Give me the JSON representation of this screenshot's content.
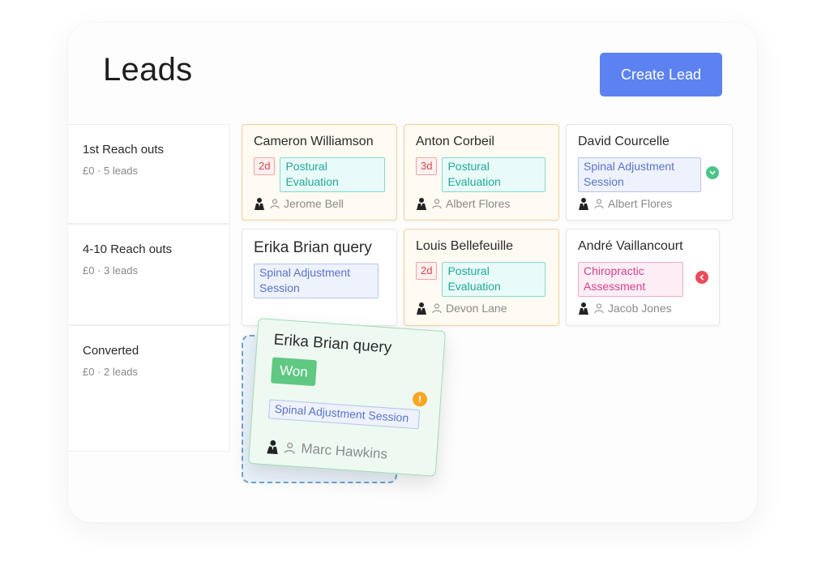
{
  "header": {
    "title": "Leads",
    "create_label": "Create Lead"
  },
  "stages": [
    {
      "name": "1st Reach outs",
      "amount": "£0",
      "count": "5 leads"
    },
    {
      "name": "4-10 Reach outs",
      "amount": "£0",
      "count": "3 leads"
    },
    {
      "name": "Converted",
      "amount": "£0",
      "count": "2 leads"
    }
  ],
  "cards": {
    "c1": {
      "name": "Cameron Williamson",
      "days": "2d",
      "tag": "Postural Evaluation",
      "owner": "Jerome Bell"
    },
    "c2": {
      "name": "Anton Corbeil",
      "days": "3d",
      "tag": "Postural Evaluation",
      "owner": "Albert Flores"
    },
    "c3": {
      "name": "David Courcelle",
      "tag": "Spinal Adjustment Session",
      "owner": "Albert Flores",
      "status": "ok"
    },
    "c4": {
      "name": "Erika Brian query",
      "tag": "Spinal Adjustment Session"
    },
    "c5": {
      "name": "Louis Bellefeuille",
      "days": "2d",
      "tag": "Postural Evaluation",
      "owner": "Devon Lane"
    },
    "c6": {
      "name": "André Vaillancourt",
      "tag": "Chiropractic Assessment",
      "owner": "Jacob Jones",
      "status": "back"
    }
  },
  "dragging": {
    "name": "Erika Brian query",
    "badge": "Won",
    "tag": "Spinal Adjustment Session",
    "owner": "Marc Hawkins",
    "status": "alert"
  },
  "colors": {
    "accent": "#5b82f0",
    "ok": "#4cc38a",
    "alert": "#f5a623",
    "back": "#ee4b5a",
    "won": "#5fc882"
  }
}
